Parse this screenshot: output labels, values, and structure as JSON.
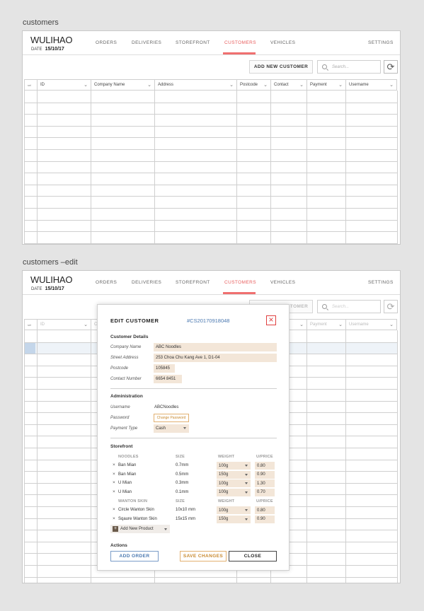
{
  "screens": [
    {
      "label": "customers"
    },
    {
      "label": "customers –edit"
    }
  ],
  "app": {
    "brand": "WULIHAO",
    "date_label": "DATE",
    "date_value": "15/10/17",
    "nav": [
      "ORDERS",
      "DELIVERIES",
      "STOREFRONT",
      "CUSTOMERS",
      "VEHICLES"
    ],
    "active_nav": "CUSTOMERS",
    "settings": "SETTINGS",
    "accent_color": "#f07070"
  },
  "toolbar": {
    "add_customer": "ADD NEW CUSTOMER",
    "search_placeholder": "Search...",
    "refresh_icon": "refresh-icon",
    "search_icon": "search-icon"
  },
  "table": {
    "columns": [
      "ID",
      "Company Name",
      "Address",
      "Postcode",
      "Contact",
      "Payment",
      "Username"
    ],
    "select_all_label": "sel"
  },
  "edit_modal": {
    "title": "EDIT CUSTOMER",
    "customer_id": "#CS20170918048",
    "close_icon": "close-icon",
    "customer_details": {
      "heading": "Customer Details",
      "fields": [
        {
          "label": "Company Name",
          "value": "ABC Noodles"
        },
        {
          "label": "Street Address",
          "value": "253 Choa Chu Kang Ave 1, D1-04"
        },
        {
          "label": "Postcode",
          "value": "105845"
        },
        {
          "label": "Contact Number",
          "value": "6654 8451"
        }
      ]
    },
    "administration": {
      "heading": "Administration",
      "username_label": "Username",
      "username_value": "ABCNoodles",
      "password_label": "Password",
      "change_password": "Change Password",
      "payment_label": "Payment Type",
      "payment_value": "Cash"
    },
    "storefront": {
      "heading": "Storefront",
      "groups": [
        {
          "name": "NOODLES",
          "size_col": "SIZE",
          "weight_col": "WEIGHT",
          "price_col": "U/PRICE",
          "items": [
            {
              "name": "Ban Mian",
              "size": "0.7mm",
              "weight": "100g",
              "price": "0.80"
            },
            {
              "name": "Ban Mian",
              "size": "0.5mm",
              "weight": "150g",
              "price": "0.90"
            },
            {
              "name": "U Mian",
              "size": "0.3mm",
              "weight": "100g",
              "price": "1.30"
            },
            {
              "name": "U Mian",
              "size": "0.1mm",
              "weight": "100g",
              "price": "0.70"
            }
          ]
        },
        {
          "name": "WANTON SKIN",
          "size_col": "SIZE",
          "weight_col": "WEIGHT",
          "price_col": "U/PRICE",
          "items": [
            {
              "name": "Circle Wanton Skin",
              "size": "10x10 mm",
              "weight": "100g",
              "price": "0.80"
            },
            {
              "name": "Sqaure Wanton Skin",
              "size": "15x15 mm",
              "weight": "150g",
              "price": "0.90"
            }
          ]
        }
      ],
      "add_product": "Add New Product",
      "remove_glyph": "×"
    },
    "actions": {
      "heading": "Actions",
      "add_order": "ADD ORDER",
      "save_changes": "SAVE CHANGES",
      "close": "CLOSE"
    }
  }
}
